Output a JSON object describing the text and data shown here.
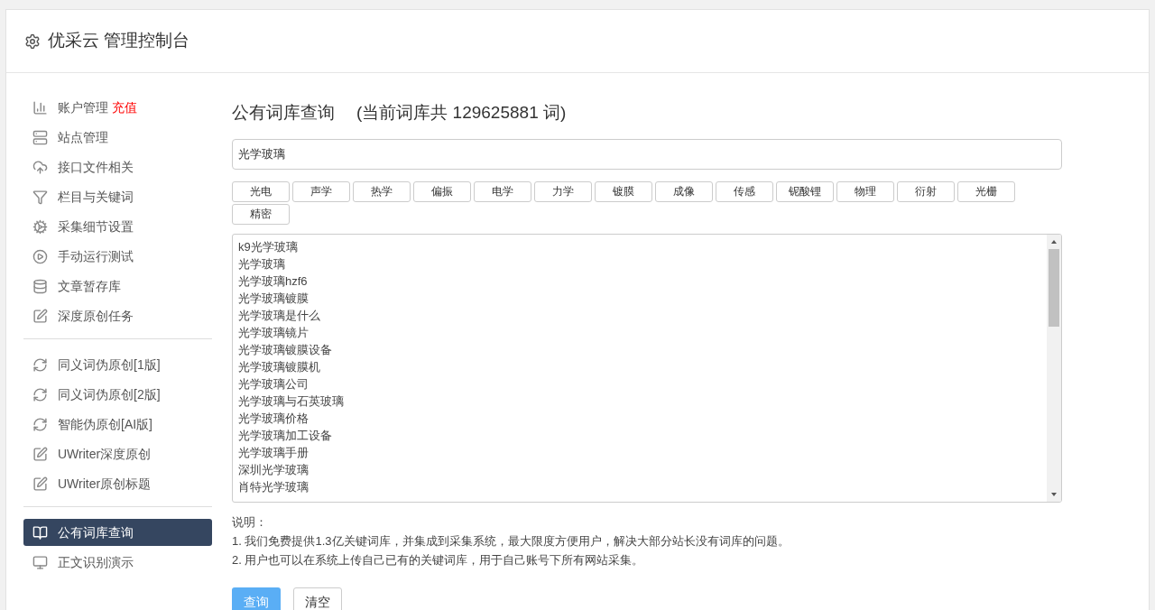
{
  "header": {
    "title": "优采云 管理控制台"
  },
  "sidebar": {
    "groups": [
      {
        "items": [
          {
            "label": "账户管理",
            "badge": "充值",
            "selected": false
          },
          {
            "label": "站点管理",
            "selected": false
          },
          {
            "label": "接口文件相关",
            "selected": false
          },
          {
            "label": "栏目与关键词",
            "selected": false
          },
          {
            "label": "采集细节设置",
            "selected": false
          },
          {
            "label": "手动运行测试",
            "selected": false
          },
          {
            "label": "文章暂存库",
            "selected": false
          },
          {
            "label": "深度原创任务",
            "selected": false
          }
        ]
      },
      {
        "items": [
          {
            "label": "同义词伪原创[1版]",
            "selected": false
          },
          {
            "label": "同义词伪原创[2版]",
            "selected": false
          },
          {
            "label": "智能伪原创[AI版]",
            "selected": false
          },
          {
            "label": "UWriter深度原创",
            "selected": false
          },
          {
            "label": "UWriter原创标题",
            "selected": false
          }
        ]
      },
      {
        "items": [
          {
            "label": "公有词库查询",
            "selected": true
          },
          {
            "label": "正文识别演示",
            "selected": false
          }
        ]
      }
    ]
  },
  "main": {
    "title": "公有词库查询",
    "subtitle": "(当前词库共 129625881 词)",
    "search": {
      "value": "光学玻璃"
    },
    "tags": [
      "光电",
      "声学",
      "热学",
      "偏振",
      "电学",
      "力学",
      "镀膜",
      "成像",
      "传感",
      "铌酸锂",
      "物理",
      "衍射",
      "光栅",
      "精密"
    ],
    "results": [
      "k9光学玻璃",
      "光学玻璃",
      "光学玻璃hzf6",
      "光学玻璃镀膜",
      "光学玻璃是什么",
      "光学玻璃镜片",
      "光学玻璃镀膜设备",
      "光学玻璃镀膜机",
      "光学玻璃公司",
      "光学玻璃与石英玻璃",
      "光学玻璃价格",
      "光学玻璃加工设备",
      "光学玻璃手册",
      "深圳光学玻璃",
      "肖特光学玻璃"
    ],
    "notes_title": "说明：",
    "notes": [
      "1. 我们免费提供1.3亿关键词库，并集成到采集系统，最大限度方便用户，解决大部分站长没有词库的问题。",
      "2. 用户也可以在系统上传自己已有的关键词库，用于自己账号下所有网站采集。"
    ],
    "buttons": [
      {
        "label": "查询",
        "kind": "primary"
      },
      {
        "label": "清空",
        "kind": "default"
      }
    ]
  }
}
